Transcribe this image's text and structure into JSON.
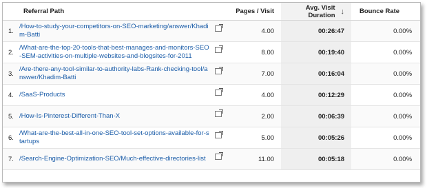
{
  "table": {
    "headers": {
      "path": "Referral Path",
      "pages": "Pages / Visit",
      "duration": "Avg. Visit Duration",
      "bounce": "Bounce Rate"
    },
    "sort_arrow": "↓",
    "rows": [
      {
        "num": "1.",
        "path": "/How-to-study-your-competitors-on-SEO-marketing/answer/Khadim-Batti",
        "pages": "4.00",
        "duration": "00:26:47",
        "bounce": "0.00%"
      },
      {
        "num": "2.",
        "path": "/What-are-the-top-20-tools-that-best-manages-and-monitors-SEO-SEM-activities-on-multiple-websites-and-blogsites-for-2011",
        "pages": "8.00",
        "duration": "00:19:40",
        "bounce": "0.00%"
      },
      {
        "num": "3.",
        "path": "/Are-there-any-tool-similar-to-authority-labs-Rank-checking-tool/answer/Khadim-Batti",
        "pages": "7.00",
        "duration": "00:16:04",
        "bounce": "0.00%"
      },
      {
        "num": "4.",
        "path": "/SaaS-Products",
        "pages": "4.00",
        "duration": "00:12:29",
        "bounce": "0.00%"
      },
      {
        "num": "5.",
        "path": "/How-Is-Pinterest-Different-Than-X",
        "pages": "2.00",
        "duration": "00:06:39",
        "bounce": "0.00%"
      },
      {
        "num": "6.",
        "path": "/What-are-the-best-all-in-one-SEO-tool-set-options-available-for-startups",
        "pages": "5.00",
        "duration": "00:05:26",
        "bounce": "0.00%"
      },
      {
        "num": "7.",
        "path": "/Search-Engine-Optimization-SEO/Much-effective-directories-list",
        "pages": "11.00",
        "duration": "00:05:18",
        "bounce": "0.00%"
      }
    ]
  }
}
